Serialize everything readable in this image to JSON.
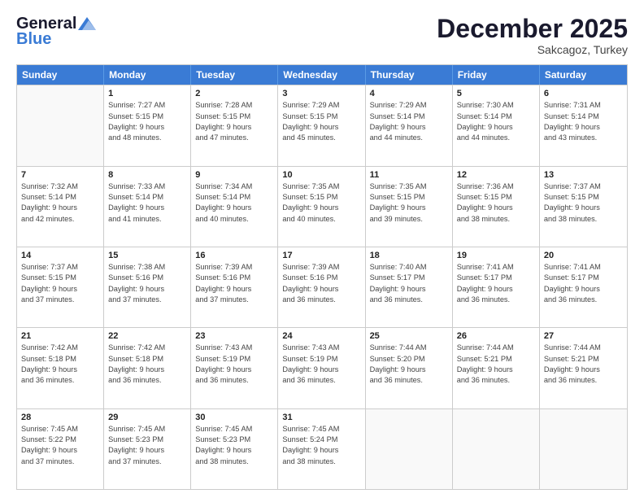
{
  "header": {
    "logo_line1": "General",
    "logo_line2": "Blue",
    "month": "December 2025",
    "location": "Sakcagoz, Turkey"
  },
  "weekdays": [
    "Sunday",
    "Monday",
    "Tuesday",
    "Wednesday",
    "Thursday",
    "Friday",
    "Saturday"
  ],
  "weeks": [
    [
      {
        "day": "",
        "info": ""
      },
      {
        "day": "1",
        "info": "Sunrise: 7:27 AM\nSunset: 5:15 PM\nDaylight: 9 hours\nand 48 minutes."
      },
      {
        "day": "2",
        "info": "Sunrise: 7:28 AM\nSunset: 5:15 PM\nDaylight: 9 hours\nand 47 minutes."
      },
      {
        "day": "3",
        "info": "Sunrise: 7:29 AM\nSunset: 5:15 PM\nDaylight: 9 hours\nand 45 minutes."
      },
      {
        "day": "4",
        "info": "Sunrise: 7:29 AM\nSunset: 5:14 PM\nDaylight: 9 hours\nand 44 minutes."
      },
      {
        "day": "5",
        "info": "Sunrise: 7:30 AM\nSunset: 5:14 PM\nDaylight: 9 hours\nand 44 minutes."
      },
      {
        "day": "6",
        "info": "Sunrise: 7:31 AM\nSunset: 5:14 PM\nDaylight: 9 hours\nand 43 minutes."
      }
    ],
    [
      {
        "day": "7",
        "info": "Sunrise: 7:32 AM\nSunset: 5:14 PM\nDaylight: 9 hours\nand 42 minutes."
      },
      {
        "day": "8",
        "info": "Sunrise: 7:33 AM\nSunset: 5:14 PM\nDaylight: 9 hours\nand 41 minutes."
      },
      {
        "day": "9",
        "info": "Sunrise: 7:34 AM\nSunset: 5:14 PM\nDaylight: 9 hours\nand 40 minutes."
      },
      {
        "day": "10",
        "info": "Sunrise: 7:35 AM\nSunset: 5:15 PM\nDaylight: 9 hours\nand 40 minutes."
      },
      {
        "day": "11",
        "info": "Sunrise: 7:35 AM\nSunset: 5:15 PM\nDaylight: 9 hours\nand 39 minutes."
      },
      {
        "day": "12",
        "info": "Sunrise: 7:36 AM\nSunset: 5:15 PM\nDaylight: 9 hours\nand 38 minutes."
      },
      {
        "day": "13",
        "info": "Sunrise: 7:37 AM\nSunset: 5:15 PM\nDaylight: 9 hours\nand 38 minutes."
      }
    ],
    [
      {
        "day": "14",
        "info": "Sunrise: 7:37 AM\nSunset: 5:15 PM\nDaylight: 9 hours\nand 37 minutes."
      },
      {
        "day": "15",
        "info": "Sunrise: 7:38 AM\nSunset: 5:16 PM\nDaylight: 9 hours\nand 37 minutes."
      },
      {
        "day": "16",
        "info": "Sunrise: 7:39 AM\nSunset: 5:16 PM\nDaylight: 9 hours\nand 37 minutes."
      },
      {
        "day": "17",
        "info": "Sunrise: 7:39 AM\nSunset: 5:16 PM\nDaylight: 9 hours\nand 36 minutes."
      },
      {
        "day": "18",
        "info": "Sunrise: 7:40 AM\nSunset: 5:17 PM\nDaylight: 9 hours\nand 36 minutes."
      },
      {
        "day": "19",
        "info": "Sunrise: 7:41 AM\nSunset: 5:17 PM\nDaylight: 9 hours\nand 36 minutes."
      },
      {
        "day": "20",
        "info": "Sunrise: 7:41 AM\nSunset: 5:17 PM\nDaylight: 9 hours\nand 36 minutes."
      }
    ],
    [
      {
        "day": "21",
        "info": "Sunrise: 7:42 AM\nSunset: 5:18 PM\nDaylight: 9 hours\nand 36 minutes."
      },
      {
        "day": "22",
        "info": "Sunrise: 7:42 AM\nSunset: 5:18 PM\nDaylight: 9 hours\nand 36 minutes."
      },
      {
        "day": "23",
        "info": "Sunrise: 7:43 AM\nSunset: 5:19 PM\nDaylight: 9 hours\nand 36 minutes."
      },
      {
        "day": "24",
        "info": "Sunrise: 7:43 AM\nSunset: 5:19 PM\nDaylight: 9 hours\nand 36 minutes."
      },
      {
        "day": "25",
        "info": "Sunrise: 7:44 AM\nSunset: 5:20 PM\nDaylight: 9 hours\nand 36 minutes."
      },
      {
        "day": "26",
        "info": "Sunrise: 7:44 AM\nSunset: 5:21 PM\nDaylight: 9 hours\nand 36 minutes."
      },
      {
        "day": "27",
        "info": "Sunrise: 7:44 AM\nSunset: 5:21 PM\nDaylight: 9 hours\nand 36 minutes."
      }
    ],
    [
      {
        "day": "28",
        "info": "Sunrise: 7:45 AM\nSunset: 5:22 PM\nDaylight: 9 hours\nand 37 minutes."
      },
      {
        "day": "29",
        "info": "Sunrise: 7:45 AM\nSunset: 5:23 PM\nDaylight: 9 hours\nand 37 minutes."
      },
      {
        "day": "30",
        "info": "Sunrise: 7:45 AM\nSunset: 5:23 PM\nDaylight: 9 hours\nand 38 minutes."
      },
      {
        "day": "31",
        "info": "Sunrise: 7:45 AM\nSunset: 5:24 PM\nDaylight: 9 hours\nand 38 minutes."
      },
      {
        "day": "",
        "info": ""
      },
      {
        "day": "",
        "info": ""
      },
      {
        "day": "",
        "info": ""
      }
    ]
  ]
}
